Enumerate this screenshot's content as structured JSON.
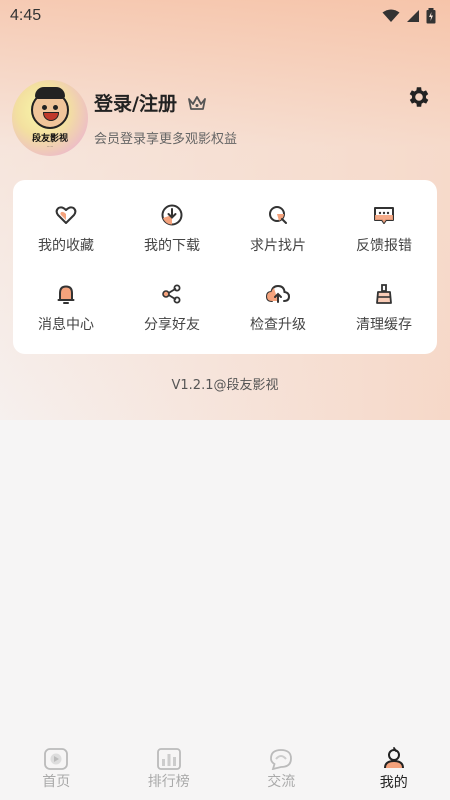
{
  "status_bar": {
    "time": "4:45"
  },
  "profile": {
    "avatar_text": "段友影视",
    "login_label": "登录/注册",
    "vip_hint": "会员登录享更多观影权益"
  },
  "menu": {
    "items": [
      {
        "label": "我的收藏",
        "icon": "heart-icon"
      },
      {
        "label": "我的下载",
        "icon": "download-icon"
      },
      {
        "label": "求片找片",
        "icon": "search-film-icon"
      },
      {
        "label": "反馈报错",
        "icon": "feedback-icon"
      },
      {
        "label": "消息中心",
        "icon": "bell-icon"
      },
      {
        "label": "分享好友",
        "icon": "share-icon"
      },
      {
        "label": "检查升级",
        "icon": "cloud-upload-icon"
      },
      {
        "label": "清理缓存",
        "icon": "broom-icon"
      }
    ]
  },
  "version": "V1.2.1@段友影视",
  "tabbar": {
    "tabs": [
      {
        "label": "首页",
        "icon": "home-icon"
      },
      {
        "label": "排行榜",
        "icon": "ranking-icon"
      },
      {
        "label": "交流",
        "icon": "chat-icon"
      },
      {
        "label": "我的",
        "icon": "profile-icon"
      }
    ],
    "active": "我的"
  },
  "colors": {
    "accent": "#f4a27c",
    "background": "#f6f5f5",
    "card": "#ffffff"
  }
}
